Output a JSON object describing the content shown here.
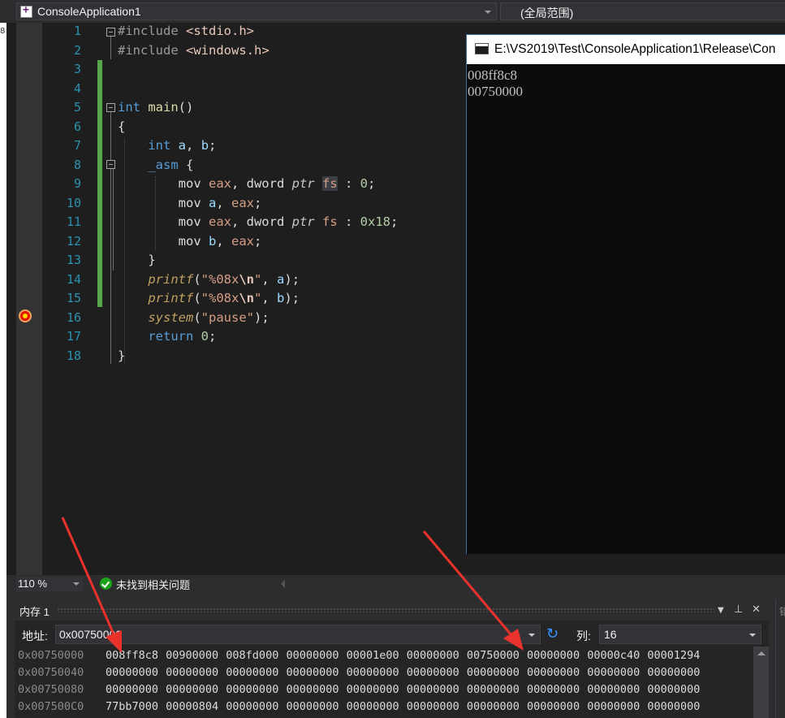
{
  "navbar": {
    "project": "ConsoleApplication1",
    "scope": "(全局范围)"
  },
  "edge_glyph": "8",
  "code_lines": [
    {
      "n": "1",
      "tokens": [
        [
          "pp",
          "#include "
        ],
        [
          "inc",
          "<stdio.h>"
        ]
      ]
    },
    {
      "n": "2",
      "tokens": [
        [
          "pp",
          "#include "
        ],
        [
          "inc",
          "<windows.h>"
        ]
      ]
    },
    {
      "n": "3",
      "tokens": []
    },
    {
      "n": "4",
      "tokens": []
    },
    {
      "n": "5",
      "tokens": [
        [
          "kw",
          "int"
        ],
        [
          "",
          " "
        ],
        [
          "fn",
          "main"
        ],
        [
          "",
          "()"
        ]
      ]
    },
    {
      "n": "6",
      "tokens": [
        [
          "",
          "{"
        ]
      ]
    },
    {
      "n": "7",
      "tokens": [
        [
          "",
          "    "
        ],
        [
          "kw",
          "int"
        ],
        [
          "",
          " "
        ],
        [
          "var",
          "a"
        ],
        [
          "",
          ", "
        ],
        [
          "var",
          "b"
        ],
        [
          "",
          ";"
        ]
      ]
    },
    {
      "n": "8",
      "tokens": [
        [
          "",
          "    "
        ],
        [
          "asmkw",
          "_asm"
        ],
        [
          "",
          " {"
        ]
      ]
    },
    {
      "n": "9",
      "tokens": [
        [
          "",
          "        mov "
        ],
        [
          "reg",
          "eax"
        ],
        [
          "",
          ", dword "
        ],
        [
          "ptr",
          "ptr"
        ],
        [
          "",
          " "
        ],
        [
          "fs",
          "fs"
        ],
        [
          "",
          " : "
        ],
        [
          "num",
          "0"
        ],
        [
          "",
          ";"
        ]
      ]
    },
    {
      "n": "10",
      "tokens": [
        [
          "",
          "        mov "
        ],
        [
          "var",
          "a"
        ],
        [
          "",
          ", "
        ],
        [
          "reg",
          "eax"
        ],
        [
          "",
          ";"
        ]
      ]
    },
    {
      "n": "11",
      "tokens": [
        [
          "",
          "        mov "
        ],
        [
          "reg",
          "eax"
        ],
        [
          "",
          ", dword "
        ],
        [
          "ptr",
          "ptr"
        ],
        [
          "",
          " "
        ],
        [
          "reg",
          "fs"
        ],
        [
          "",
          " : "
        ],
        [
          "num",
          "0x18"
        ],
        [
          "",
          ";"
        ]
      ]
    },
    {
      "n": "12",
      "tokens": [
        [
          "",
          "        mov "
        ],
        [
          "var",
          "b"
        ],
        [
          "",
          ", "
        ],
        [
          "reg",
          "eax"
        ],
        [
          "",
          ";"
        ]
      ]
    },
    {
      "n": "13",
      "tokens": [
        [
          "",
          "    }"
        ]
      ]
    },
    {
      "n": "14",
      "tokens": [
        [
          "",
          "    "
        ],
        [
          "call",
          "printf"
        ],
        [
          "",
          "("
        ],
        [
          "str",
          "\"%08x"
        ],
        [
          "esc",
          "\\n"
        ],
        [
          "str",
          "\""
        ],
        [
          "",
          ", "
        ],
        [
          "var",
          "a"
        ],
        [
          "",
          ");"
        ]
      ]
    },
    {
      "n": "15",
      "tokens": [
        [
          "",
          "    "
        ],
        [
          "call",
          "printf"
        ],
        [
          "",
          "("
        ],
        [
          "str",
          "\"%08x"
        ],
        [
          "esc",
          "\\n"
        ],
        [
          "str",
          "\""
        ],
        [
          "",
          ", "
        ],
        [
          "var",
          "b"
        ],
        [
          "",
          ");"
        ]
      ]
    },
    {
      "n": "16",
      "tokens": [
        [
          "",
          "    "
        ],
        [
          "call",
          "system"
        ],
        [
          "",
          "("
        ],
        [
          "str",
          "\"pause\""
        ],
        [
          "",
          ");"
        ]
      ]
    },
    {
      "n": "17",
      "tokens": [
        [
          "",
          "    "
        ],
        [
          "kw",
          "return"
        ],
        [
          "",
          " "
        ],
        [
          "num",
          "0"
        ],
        [
          "",
          ";"
        ]
      ]
    },
    {
      "n": "18",
      "tokens": [
        [
          "",
          "}"
        ]
      ]
    }
  ],
  "console": {
    "title": "E:\\VS2019\\Test\\ConsoleApplication1\\Release\\Con",
    "output": [
      "008ff8c8",
      "00750000"
    ]
  },
  "status": {
    "zoom": "110 %",
    "issues": "未找到相关问题"
  },
  "memory": {
    "title": "内存 1",
    "address_label": "地址:",
    "address_value": "0x00750000",
    "columns_label": "列:",
    "columns_value": "16",
    "rows": [
      {
        "addr": "0x00750000",
        "bytes": "008ff8c8 00900000 008fd000 00000000 00001e00 00000000 00750000 00000000 00000c40 00001294"
      },
      {
        "addr": "0x00750040",
        "bytes": "00000000 00000000 00000000 00000000 00000000 00000000 00000000 00000000 00000000 00000000"
      },
      {
        "addr": "0x00750080",
        "bytes": "00000000 00000000 00000000 00000000 00000000 00000000 00000000 00000000 00000000 00000000"
      },
      {
        "addr": "0x007500C0",
        "bytes": "77bb7000 00000804 00000000 00000000 00000000 00000000 00000000 00000000 00000000 00000000"
      }
    ]
  },
  "colors": {
    "accent": "#007acc",
    "arrow": "#e8322b",
    "changebar": "#57a64a",
    "breakpoint": "#e51400"
  },
  "icons": [
    "project-icon",
    "console-app-icon",
    "breakpoint-icon",
    "check-icon",
    "refresh-icon",
    "pin-icon",
    "close-icon",
    "dropdown-caret-icon",
    "scroll-up-icon",
    "fold-icon"
  ]
}
